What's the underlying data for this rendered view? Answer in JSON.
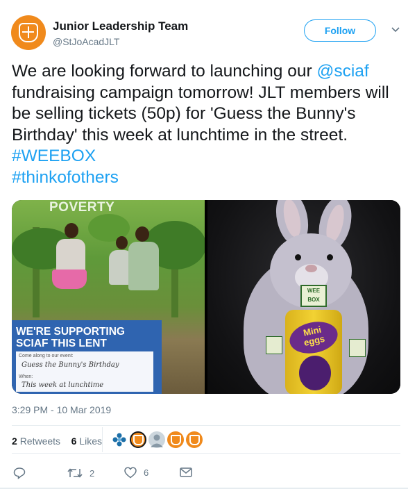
{
  "author": {
    "name": "Junior Leadership Team",
    "handle": "@StJoAcadJLT",
    "avatar_color": "#f08a1c"
  },
  "follow_label": "Follow",
  "tweet": {
    "line1": "We are looking forward to launching our",
    "mention": "@sciaf",
    "line2_rest": " fundraising campaign tomorrow! JLT members will be selling tickets (50p) for 'Guess the Bunny's Birthday' this week at lunchtime in the street. ",
    "hashtag1": "#WEEBOX",
    "hashtag2": "#thinkofothers"
  },
  "media": {
    "left_photo": {
      "banner_text": "POVERTY",
      "poster_heading_line1": "WE'RE SUPPORTING",
      "poster_heading_line2": "SCIAF THIS LENT",
      "come_along_label": "Come along to our event:",
      "event_handwriting": "Guess the Bunny's Birthday",
      "when_label": "When:",
      "when_handwriting": "This week at lunchtime"
    },
    "right_photo": {
      "box_label_line1": "WEE",
      "box_label_line2": "BOX",
      "egg_label_line1": "Mini",
      "egg_label_line2": "eggs"
    }
  },
  "timestamp": "3:29 PM - 10 Mar 2019",
  "stats": {
    "retweets_count": "2",
    "retweets_label": "Retweets",
    "likes_count": "6",
    "likes_label": "Likes"
  },
  "actions": {
    "reply_icon": "reply-icon",
    "retweet_count": "2",
    "like_count": "6",
    "message_icon": "envelope-icon"
  },
  "colors": {
    "accent": "#1da1f2",
    "text": "#14171a",
    "muted": "#657786"
  }
}
